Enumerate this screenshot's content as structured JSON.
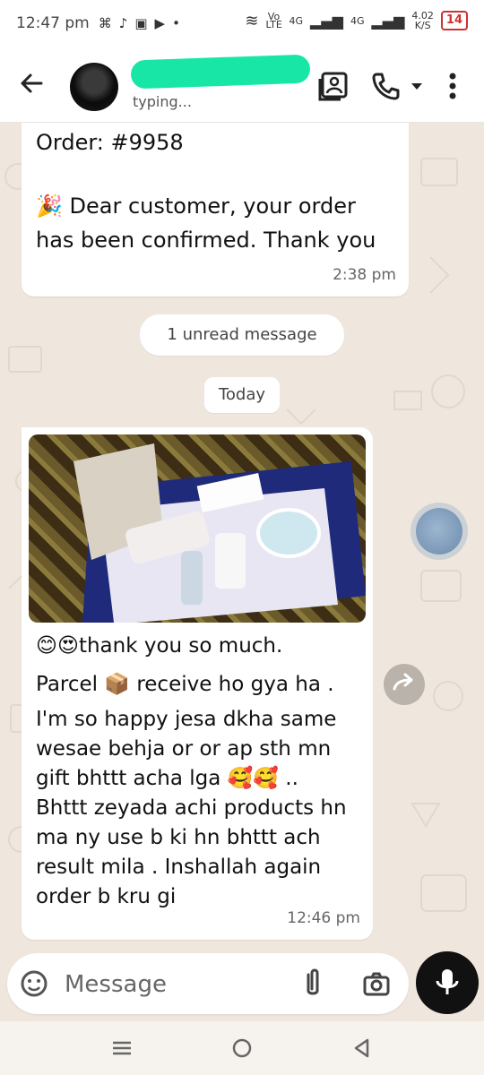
{
  "status_bar": {
    "time": "12:47 pm",
    "network_left": "Vo LTE",
    "net1": "4G",
    "net2": "4G",
    "speed_value": "4.02",
    "speed_unit": "K/S",
    "battery": "14"
  },
  "header": {
    "contact_status": "typing..."
  },
  "messages": {
    "order_number": "Order: #9958",
    "confirmation": "🎉 Dear customer, your order has been confirmed. Thank you",
    "confirmation_time": "2:38 pm",
    "unread_banner": "1 unread message",
    "date_pill": "Today",
    "reply_text_1": "😊😍thank you so much.",
    "reply_text_2": "Parcel 📦 receive ho gya ha .",
    "reply_text_3": "I'm so happy jesa dkha same wesae behja or or ap sth mn gift bhttt acha lga 🥰🥰 ..",
    "reply_text_4": "Bhttt zeyada achi products hn ma ny use b ki hn bhttt ach result mila . Inshallah again order b kru gi",
    "reply_time": "12:46 pm"
  },
  "composer": {
    "placeholder": "Message"
  },
  "icons": {
    "back": "arrow-left",
    "gallery": "gallery-icon",
    "call": "phone-icon",
    "menu": "more-vertical-icon",
    "emoji": "sticker-icon",
    "attach": "paperclip-icon",
    "camera": "camera-icon",
    "mic": "microphone-icon",
    "forward": "forward-icon"
  }
}
